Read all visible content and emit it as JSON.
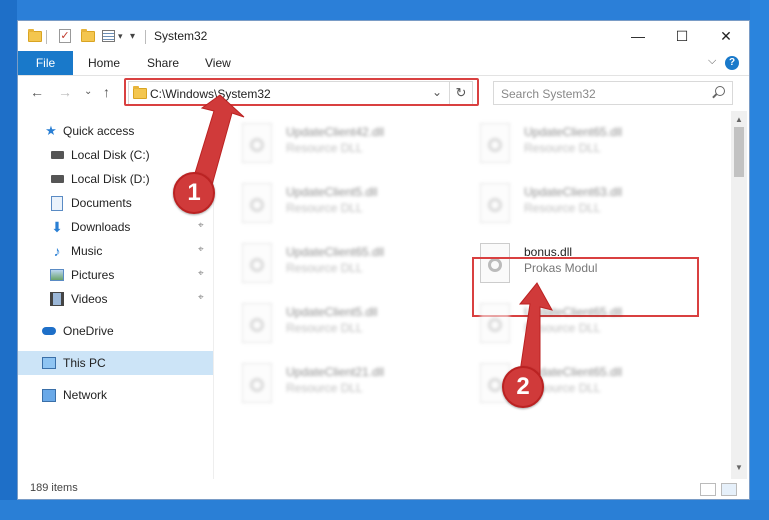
{
  "title_bar": {
    "window_title": "System32",
    "dropdown_glyph": "▾",
    "controls": {
      "minimize": "—",
      "maximize": "☐",
      "close": "✕"
    }
  },
  "ribbon": {
    "tabs": [
      "File",
      "Home",
      "Share",
      "View"
    ],
    "expand_glyph": "⌵",
    "help": "?"
  },
  "navigation": {
    "back": "←",
    "forward": "→",
    "recent": "⌄",
    "up": "↑",
    "address": "C:\\Windows\\System32",
    "address_dropdown": "⌄",
    "refresh": "↻",
    "search_placeholder": "Search System32"
  },
  "sidebar": {
    "items": [
      {
        "label": "Quick access",
        "icon": "star-icon"
      },
      {
        "label": "Local Disk (C:)",
        "icon": "drive-icon"
      },
      {
        "label": "Local Disk (D:)",
        "icon": "drive-icon"
      },
      {
        "label": "Documents",
        "icon": "documents-icon"
      },
      {
        "label": "Downloads",
        "icon": "download-icon",
        "pinned": true
      },
      {
        "label": "Music",
        "icon": "music-icon",
        "pinned": true
      },
      {
        "label": "Pictures",
        "icon": "pictures-icon",
        "pinned": true
      },
      {
        "label": "Videos",
        "icon": "videos-icon",
        "pinned": true
      },
      {
        "label": "OneDrive",
        "icon": "cloud-icon"
      },
      {
        "label": "This PC",
        "icon": "computer-icon",
        "selected": true
      },
      {
        "label": "Network",
        "icon": "network-icon"
      }
    ],
    "pin_glyph": "⌖"
  },
  "files": {
    "rows": [
      [
        {
          "name": "UpdateClient42.dll",
          "type": "Resource DLL"
        },
        {
          "name": "UpdateClient65.dll",
          "type": "Resource DLL"
        }
      ],
      [
        {
          "name": "UpdateClient5.dll",
          "type": "Resource DLL"
        },
        {
          "name": "UpdateClient63.dll",
          "type": "Resource DLL"
        }
      ],
      [
        {
          "name": "UpdateClient65.dll",
          "type": "Resource DLL"
        },
        {
          "name": "bonus.dll",
          "type": "Prokas Modul"
        }
      ],
      [
        {
          "name": "UpdateClient5.dll",
          "type": "Resource DLL"
        },
        {
          "name": "UpdateClient65.dll",
          "type": "Resource DLL"
        }
      ],
      [
        {
          "name": "UpdateClient21.dll",
          "type": "Resource DLL"
        },
        {
          "name": "UpdateClient65.dll",
          "type": "Resource DLL"
        }
      ]
    ]
  },
  "status_bar": {
    "item_count": "189 items"
  },
  "callouts": {
    "one": "1",
    "two": "2"
  },
  "colors": {
    "accent": "#1979ca",
    "highlight": "#d94040",
    "selected": "#cce4f7",
    "desktop": "#2b7fd8"
  }
}
